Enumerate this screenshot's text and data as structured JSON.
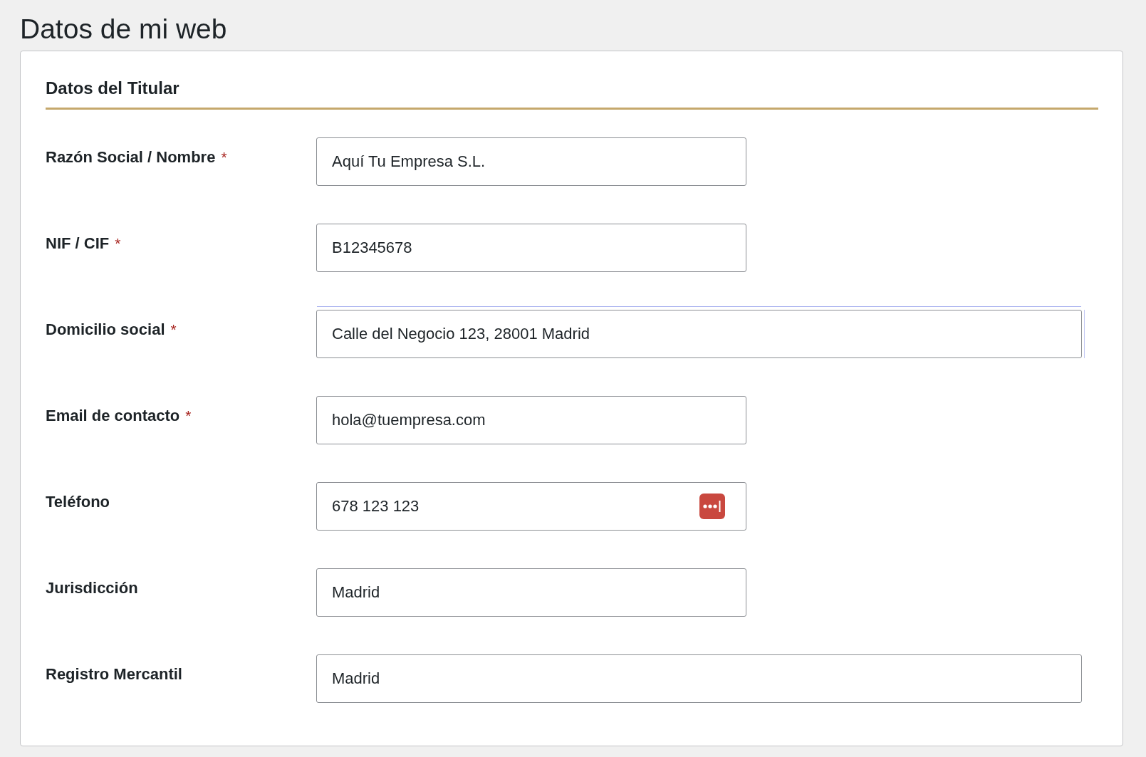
{
  "page": {
    "title": "Datos de mi web"
  },
  "section": {
    "title": "Datos del Titular"
  },
  "fields": [
    {
      "label": "Razón Social / Nombre",
      "required_mark": "*",
      "value": "Aquí Tu Empresa S.L.",
      "kind": "short",
      "focus_ring": false,
      "autofill_badge": false
    },
    {
      "label": "NIF / CIF",
      "required_mark": "*",
      "value": "B12345678",
      "kind": "short",
      "focus_ring": false,
      "autofill_badge": false
    },
    {
      "label": "Domicilio social",
      "required_mark": "*",
      "value": "Calle del Negocio 123, 28001 Madrid",
      "kind": "wide",
      "focus_ring": true,
      "autofill_badge": false
    },
    {
      "label": "Email de contacto",
      "required_mark": "*",
      "value": "hola@tuempresa.com",
      "kind": "short",
      "focus_ring": false,
      "autofill_badge": false
    },
    {
      "label": "Teléfono",
      "value": "678 123 123",
      "kind": "short",
      "focus_ring": false,
      "autofill_badge": true
    },
    {
      "label": "Jurisdicción",
      "value": "Madrid",
      "kind": "short",
      "focus_ring": false,
      "autofill_badge": false
    },
    {
      "label": "Registro Mercantil",
      "value": "Madrid",
      "kind": "wide",
      "focus_ring": false,
      "autofill_badge": false
    }
  ]
}
